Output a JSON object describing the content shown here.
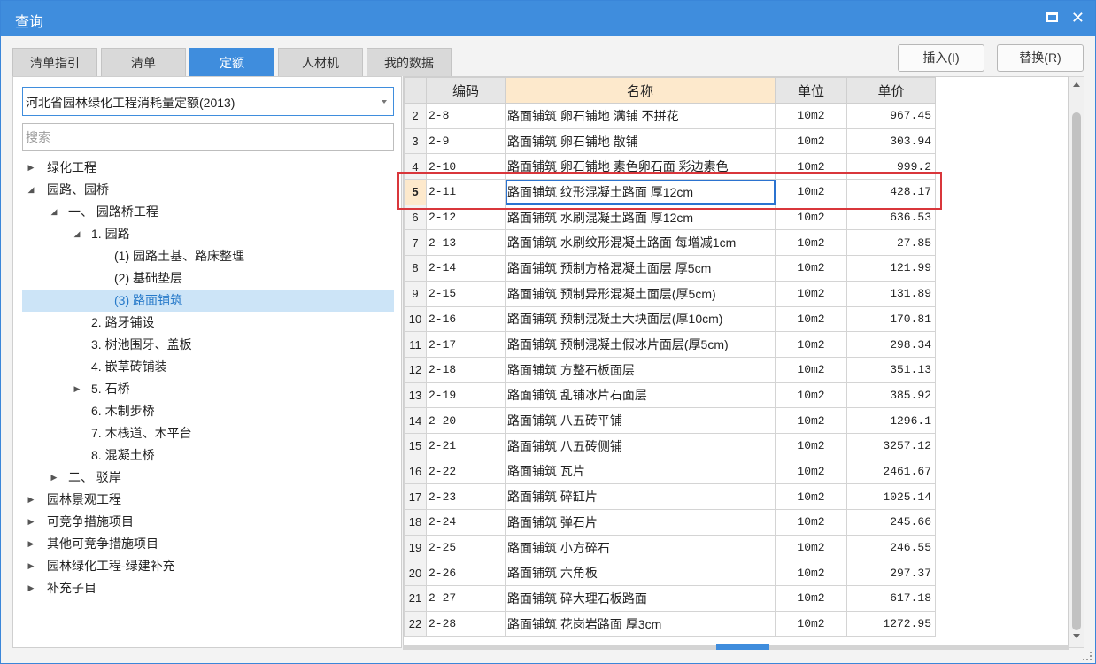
{
  "window": {
    "title": "查询",
    "maximize_label": "",
    "close_label": "✕"
  },
  "tabs": [
    "清单指引",
    "清单",
    "定额",
    "人材机",
    "我的数据"
  ],
  "active_tab_index": 2,
  "buttons": {
    "insert": "插入(I)",
    "replace": "替换(R)"
  },
  "library": {
    "selected": "河北省园林绿化工程消耗量定额(2013)"
  },
  "search": {
    "placeholder": "搜索",
    "value": ""
  },
  "tree": [
    {
      "label": "绿化工程",
      "toggle": "▶"
    },
    {
      "label": "园路、园桥",
      "toggle": "◢"
    },
    {
      "label": "一、 园路桥工程",
      "toggle": "◢"
    },
    {
      "label": "1. 园路",
      "toggle": "◢"
    },
    {
      "label": "(1) 园路土基、路床整理",
      "toggle": ""
    },
    {
      "label": "(2) 基础垫层",
      "toggle": ""
    },
    {
      "label": "(3) 路面铺筑",
      "toggle": "",
      "selected": true
    },
    {
      "label": "2. 路牙铺设",
      "toggle": ""
    },
    {
      "label": "3. 树池围牙、盖板",
      "toggle": ""
    },
    {
      "label": "4. 嵌草砖铺装",
      "toggle": ""
    },
    {
      "label": "5. 石桥",
      "toggle": "▶"
    },
    {
      "label": "6. 木制步桥",
      "toggle": ""
    },
    {
      "label": "7. 木栈道、木平台",
      "toggle": ""
    },
    {
      "label": "8. 混凝土桥",
      "toggle": ""
    },
    {
      "label": "二、 驳岸",
      "toggle": "▶"
    },
    {
      "label": "园林景观工程",
      "toggle": "▶"
    },
    {
      "label": "可竞争措施项目",
      "toggle": "▶"
    },
    {
      "label": "其他可竞争措施项目",
      "toggle": "▶"
    },
    {
      "label": "园林绿化工程-绿建补充",
      "toggle": "▶"
    },
    {
      "label": "补充子目",
      "toggle": "▶"
    }
  ],
  "table": {
    "columns": [
      "",
      "编码",
      "名称",
      "单位",
      "单价"
    ],
    "current_row": "5",
    "rows": [
      {
        "n": "2",
        "code": "2-8",
        "name": "路面铺筑 卵石铺地 满铺 不拼花",
        "unit": "10m2",
        "price": "967.45"
      },
      {
        "n": "3",
        "code": "2-9",
        "name": "路面铺筑 卵石铺地 散铺",
        "unit": "10m2",
        "price": "303.94"
      },
      {
        "n": "4",
        "code": "2-10",
        "name": "路面铺筑 卵石铺地 素色卵石面 彩边素色",
        "unit": "10m2",
        "price": "999.2"
      },
      {
        "n": "5",
        "code": "2-11",
        "name": "路面铺筑 纹形混凝土路面 厚12cm",
        "unit": "10m2",
        "price": "428.17"
      },
      {
        "n": "6",
        "code": "2-12",
        "name": "路面铺筑 水刷混凝土路面 厚12cm",
        "unit": "10m2",
        "price": "636.53"
      },
      {
        "n": "7",
        "code": "2-13",
        "name": "路面铺筑 水刷纹形混凝土路面 每增减1cm",
        "unit": "10m2",
        "price": "27.85"
      },
      {
        "n": "8",
        "code": "2-14",
        "name": "路面铺筑 预制方格混凝土面层 厚5cm",
        "unit": "10m2",
        "price": "121.99"
      },
      {
        "n": "9",
        "code": "2-15",
        "name": "路面铺筑 预制异形混凝土面层(厚5cm)",
        "unit": "10m2",
        "price": "131.89"
      },
      {
        "n": "10",
        "code": "2-16",
        "name": "路面铺筑 预制混凝土大块面层(厚10cm)",
        "unit": "10m2",
        "price": "170.81"
      },
      {
        "n": "11",
        "code": "2-17",
        "name": "路面铺筑 预制混凝土假冰片面层(厚5cm)",
        "unit": "10m2",
        "price": "298.34"
      },
      {
        "n": "12",
        "code": "2-18",
        "name": "路面铺筑 方整石板面层",
        "unit": "10m2",
        "price": "351.13"
      },
      {
        "n": "13",
        "code": "2-19",
        "name": "路面铺筑 乱铺冰片石面层",
        "unit": "10m2",
        "price": "385.92"
      },
      {
        "n": "14",
        "code": "2-20",
        "name": "路面铺筑 八五砖平铺",
        "unit": "10m2",
        "price": "1296.1"
      },
      {
        "n": "15",
        "code": "2-21",
        "name": "路面铺筑 八五砖侧铺",
        "unit": "10m2",
        "price": "3257.12"
      },
      {
        "n": "16",
        "code": "2-22",
        "name": "路面铺筑 瓦片",
        "unit": "10m2",
        "price": "2461.67"
      },
      {
        "n": "17",
        "code": "2-23",
        "name": "路面铺筑 碎缸片",
        "unit": "10m2",
        "price": "1025.14"
      },
      {
        "n": "18",
        "code": "2-24",
        "name": "路面铺筑 弹石片",
        "unit": "10m2",
        "price": "245.66"
      },
      {
        "n": "19",
        "code": "2-25",
        "name": "路面铺筑 小方碎石",
        "unit": "10m2",
        "price": "246.55"
      },
      {
        "n": "20",
        "code": "2-26",
        "name": "路面铺筑 六角板",
        "unit": "10m2",
        "price": "297.37"
      },
      {
        "n": "21",
        "code": "2-27",
        "name": "路面铺筑 碎大理石板路面",
        "unit": "10m2",
        "price": "617.18"
      },
      {
        "n": "22",
        "code": "2-28",
        "name": "路面铺筑 花岗岩路面 厚3cm",
        "unit": "10m2",
        "price": "1272.95"
      }
    ]
  },
  "colors": {
    "accent": "#3f8ddd",
    "highlight_header": "#fde9cc",
    "selection_box": "#d9363b",
    "tree_selected_bg": "#cce4f7"
  }
}
